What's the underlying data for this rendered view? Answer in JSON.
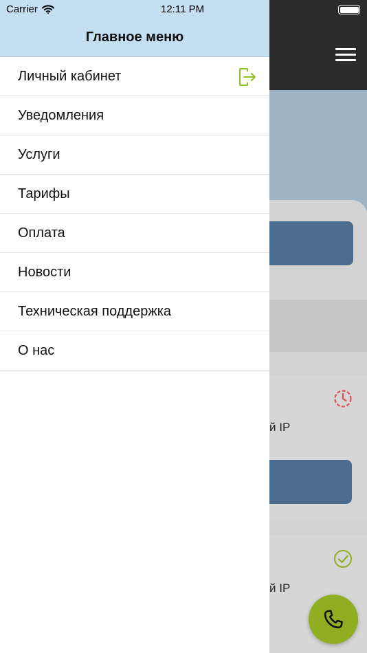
{
  "status_bar": {
    "carrier": "Carrier",
    "time": "12:11 PM"
  },
  "drawer": {
    "title": "Главное меню",
    "items": [
      {
        "label": "Личный кабинет",
        "icon": "logout-icon"
      },
      {
        "label": "Уведомления"
      },
      {
        "label": "Услуги"
      },
      {
        "label": "Тарифы"
      },
      {
        "label": "Оплата"
      },
      {
        "label": "Новости"
      },
      {
        "label": "Техническая поддержка"
      },
      {
        "label": "О нас"
      }
    ]
  },
  "background": {
    "service1_text": "й IP",
    "service1_status_icon": "clock-icon",
    "service2_text": "й IP",
    "service2_status_icon": "check-icon",
    "call_icon": "phone-icon"
  },
  "colors": {
    "drawer_header": "#c4def2",
    "accent_green": "#8fae22",
    "button_blue": "#4a6d8f",
    "status_red": "#d9534f"
  }
}
